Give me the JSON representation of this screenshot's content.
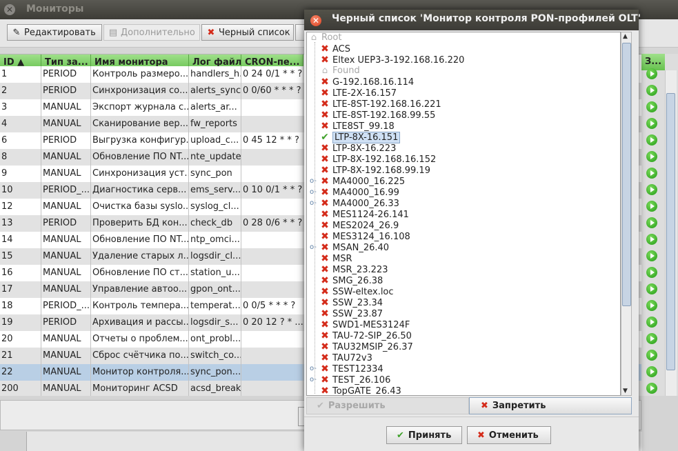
{
  "main_window": {
    "title": "Мониторы",
    "close_glyph": "✕"
  },
  "toolbar": {
    "edit_label": "Редактировать",
    "edit_icon": "pencil-icon",
    "more_label": "Дополнительно",
    "blacklist_label": "Черный список"
  },
  "table": {
    "headers": [
      "ID ▲",
      "Тип за...",
      "Имя монитора",
      "Лог файл",
      "CRON-пе...",
      "З..."
    ],
    "rows": [
      {
        "id": "1",
        "type": "PERIOD",
        "name": "Контроль размеро...",
        "log": "handlers_h...",
        "cron": "0 24 0/1 * * ?"
      },
      {
        "id": "2",
        "type": "PERIOD",
        "name": "Синхронизация со...",
        "log": "alerts_sync",
        "cron": "0 0/60 * * * ?"
      },
      {
        "id": "3",
        "type": "MANUAL",
        "name": "Экспорт журнала с...",
        "log": "alerts_ar...",
        "cron": ""
      },
      {
        "id": "4",
        "type": "MANUAL",
        "name": "Сканирование вер...",
        "log": "fw_reports",
        "cron": ""
      },
      {
        "id": "6",
        "type": "PERIOD",
        "name": "Выгрузка конфигур...",
        "log": "upload_c...",
        "cron": "0 45 12 * * ?"
      },
      {
        "id": "8",
        "type": "MANUAL",
        "name": "Обновление ПО NT...",
        "log": "nte_update",
        "cron": ""
      },
      {
        "id": "9",
        "type": "MANUAL",
        "name": "Синхронизация уст...",
        "log": "sync_pon",
        "cron": ""
      },
      {
        "id": "10",
        "type": "PERIOD_...",
        "name": "Диагностика серв...",
        "log": "ems_serv...",
        "cron": "0 10 0/1 * * ?"
      },
      {
        "id": "12",
        "type": "MANUAL",
        "name": "Очистка базы syslo...",
        "log": "syslog_cl...",
        "cron": ""
      },
      {
        "id": "13",
        "type": "PERIOD",
        "name": "Проверить БД кон...",
        "log": "check_db",
        "cron": "0 28 0/6 * * ?"
      },
      {
        "id": "14",
        "type": "MANUAL",
        "name": "Обновление ПО NT...",
        "log": "ntp_omci...",
        "cron": ""
      },
      {
        "id": "15",
        "type": "MANUAL",
        "name": "Удаление старых л...",
        "log": "logsdir_cl...",
        "cron": ""
      },
      {
        "id": "16",
        "type": "MANUAL",
        "name": "Обновление ПО ст...",
        "log": "station_u...",
        "cron": ""
      },
      {
        "id": "17",
        "type": "MANUAL",
        "name": "Управление автоо...",
        "log": "gpon_ont...",
        "cron": ""
      },
      {
        "id": "18",
        "type": "PERIOD_...",
        "name": "Контроль темпера...",
        "log": "temperat...",
        "cron": "0 0/5 * * * ?"
      },
      {
        "id": "19",
        "type": "PERIOD",
        "name": "Архивация и рассы...",
        "log": "logsdir_s...",
        "cron": "0 20 12 ? * ..."
      },
      {
        "id": "20",
        "type": "MANUAL",
        "name": "Отчеты о проблем...",
        "log": "ont_probl...",
        "cron": ""
      },
      {
        "id": "21",
        "type": "MANUAL",
        "name": "Сброс счётчика по...",
        "log": "switch_co...",
        "cron": ""
      },
      {
        "id": "22",
        "type": "MANUAL",
        "name": "Монитор контроля...",
        "log": "sync_pon...",
        "cron": ""
      },
      {
        "id": "200",
        "type": "MANUAL",
        "name": "Мониторинг ACSD",
        "log": "acsd_break",
        "cron": ""
      }
    ],
    "selected_row_index": 18
  },
  "dialog": {
    "title": "Черный список 'Монитор контроля PON-профилей OLT'",
    "close_glyph": "✕",
    "allow_label": "Разрешить",
    "deny_label": "Запретить",
    "accept_label": "Принять",
    "cancel_label": "Отменить",
    "tree": [
      {
        "label": "Root",
        "kind": "folder",
        "level": 0
      },
      {
        "label": "ACS",
        "kind": "denied",
        "level": 1
      },
      {
        "label": "Eltex UEP3-3-192.168.16.220",
        "kind": "denied",
        "level": 1
      },
      {
        "label": "Found",
        "kind": "folder",
        "level": 1
      },
      {
        "label": "G-192.168.16.114",
        "kind": "denied",
        "level": 1
      },
      {
        "label": "LTE-2X-16.157",
        "kind": "denied",
        "level": 1
      },
      {
        "label": "LTE-8ST-192.168.16.221",
        "kind": "denied",
        "level": 1
      },
      {
        "label": "LTE-8ST-192.168.99.55",
        "kind": "denied",
        "level": 1
      },
      {
        "label": "LTE8ST_99.18",
        "kind": "denied",
        "level": 1
      },
      {
        "label": "LTP-8X-16.151",
        "kind": "allowed",
        "level": 1,
        "selected": true
      },
      {
        "label": "LTP-8X-16.223",
        "kind": "denied",
        "level": 1
      },
      {
        "label": "LTP-8X-192.168.16.152",
        "kind": "denied",
        "level": 1
      },
      {
        "label": "LTP-8X-192.168.99.19",
        "kind": "denied",
        "level": 1
      },
      {
        "label": "MA4000_16.225",
        "kind": "denied",
        "level": 1,
        "expandable": true
      },
      {
        "label": "MA4000_16.99",
        "kind": "denied",
        "level": 1,
        "expandable": true
      },
      {
        "label": "MA4000_26.33",
        "kind": "denied",
        "level": 1,
        "expandable": true
      },
      {
        "label": "MES1124-26.141",
        "kind": "denied",
        "level": 1
      },
      {
        "label": "MES2024_26.9",
        "kind": "denied",
        "level": 1
      },
      {
        "label": "MES3124_16.108",
        "kind": "denied",
        "level": 1
      },
      {
        "label": "MSAN_26.40",
        "kind": "denied",
        "level": 1,
        "expandable": true
      },
      {
        "label": "MSR",
        "kind": "denied",
        "level": 1
      },
      {
        "label": "MSR_23.223",
        "kind": "denied",
        "level": 1
      },
      {
        "label": "SMG_26.38",
        "kind": "denied",
        "level": 1
      },
      {
        "label": "SSW-eltex.loc",
        "kind": "denied",
        "level": 1
      },
      {
        "label": "SSW_23.34",
        "kind": "denied",
        "level": 1
      },
      {
        "label": "SSW_23.87",
        "kind": "denied",
        "level": 1
      },
      {
        "label": "SWD1-MES3124F",
        "kind": "denied",
        "level": 1
      },
      {
        "label": "TAU-72-SIP_26.50",
        "kind": "denied",
        "level": 1
      },
      {
        "label": "TAU32MSIP_26.37",
        "kind": "denied",
        "level": 1
      },
      {
        "label": "TAU72v3",
        "kind": "denied",
        "level": 1
      },
      {
        "label": "TEST12334",
        "kind": "denied",
        "level": 1,
        "expandable": true
      },
      {
        "label": "TEST_26.106",
        "kind": "denied",
        "level": 1,
        "expandable": true
      },
      {
        "label": "TopGATE_26.43",
        "kind": "denied",
        "level": 1
      }
    ]
  },
  "icons": {
    "denied": "red-x-icon",
    "allowed": "green-check-icon",
    "folder": "home-icon",
    "run": "play-icon"
  },
  "colors": {
    "header_green": "#67c24f",
    "selected_row": "#b9cfe5",
    "deny_red": "#d42b1a",
    "allow_green": "#3fa12a"
  }
}
